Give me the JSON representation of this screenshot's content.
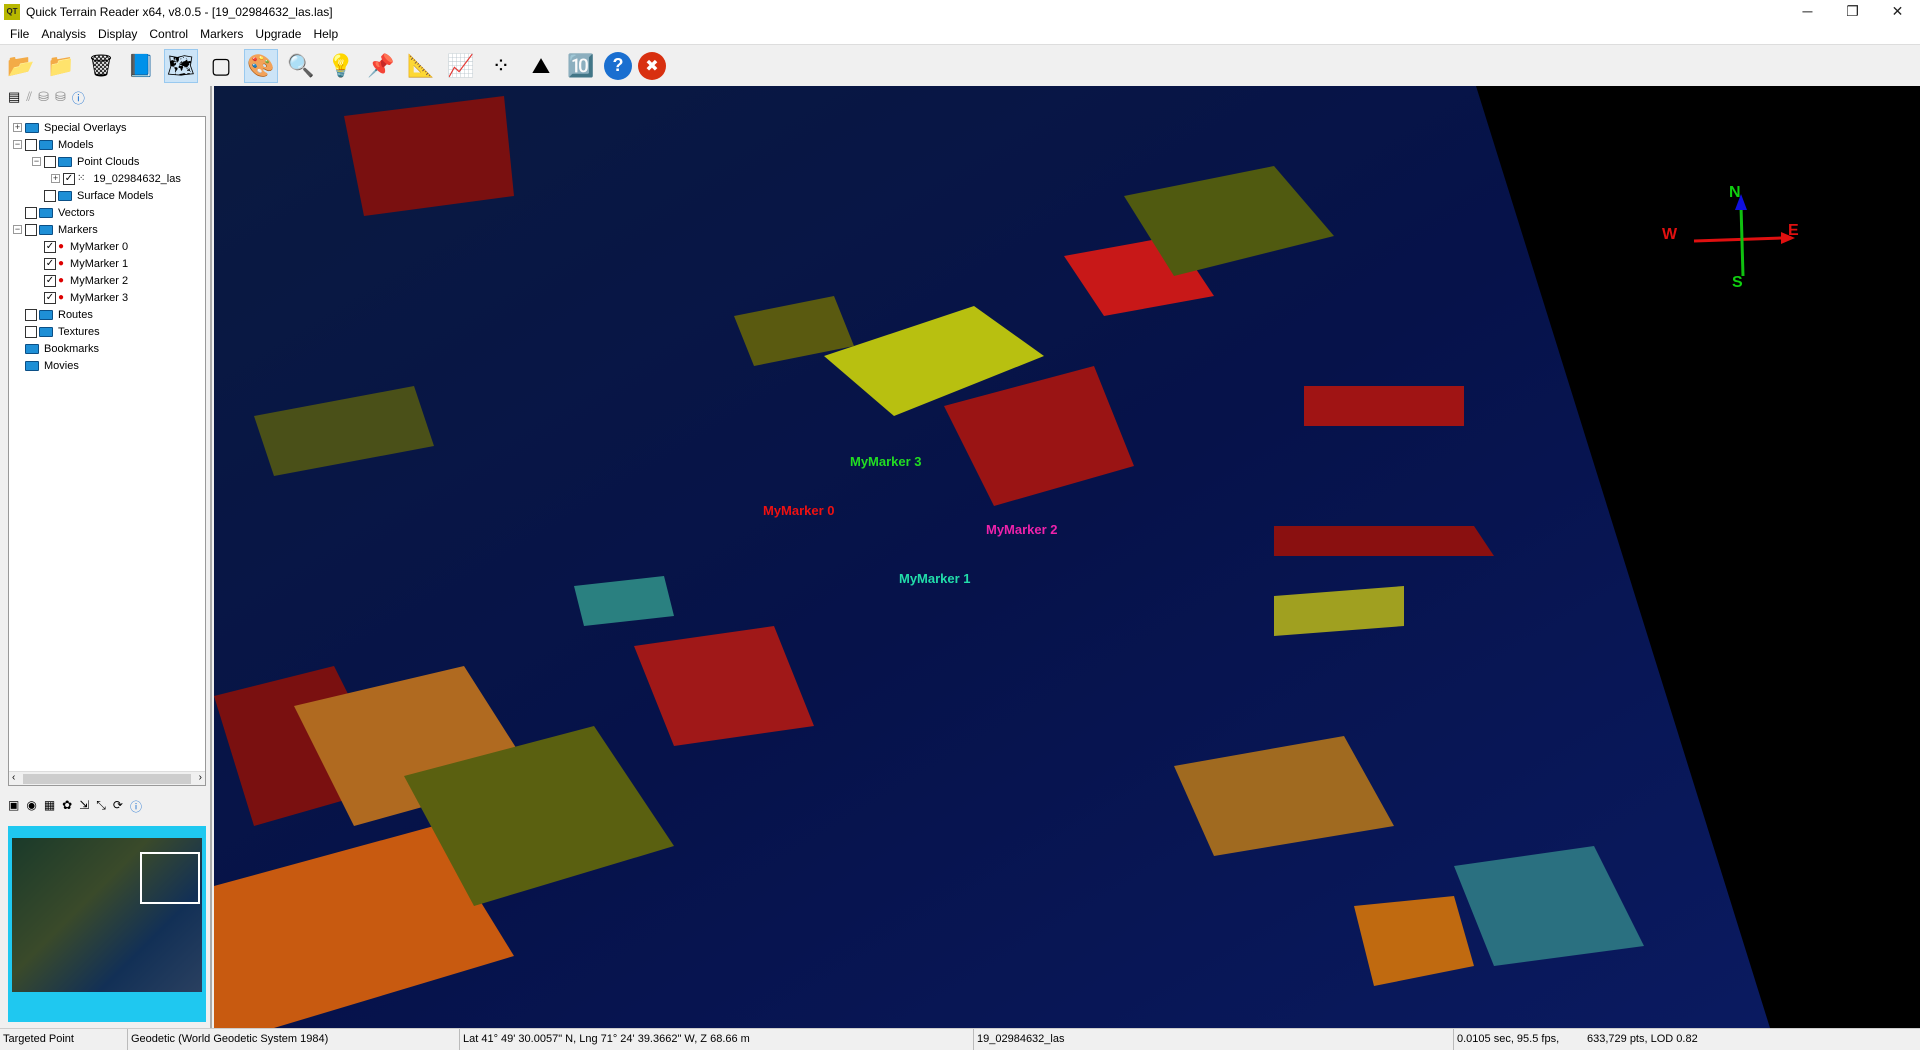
{
  "title": "Quick Terrain Reader x64, v8.0.5 - [19_02984632_las.las]",
  "logo": "QT",
  "window_controls": {
    "min": "─",
    "max": "❐",
    "close": "✕"
  },
  "menu": [
    "File",
    "Analysis",
    "Display",
    "Control",
    "Markers",
    "Upgrade",
    "Help"
  ],
  "toolbar": [
    {
      "icon": "open-folder",
      "g": "📂"
    },
    {
      "icon": "add-folder",
      "g": "📁"
    },
    {
      "icon": "trash",
      "g": "🗑"
    },
    {
      "icon": "book",
      "g": "📘"
    },
    {
      "icon": "heatmap",
      "g": "🗺"
    },
    {
      "icon": "layers",
      "g": "▢"
    },
    {
      "icon": "color",
      "g": "🎨"
    },
    {
      "icon": "zoom-extent",
      "g": "🔍"
    },
    {
      "icon": "light",
      "g": "💡"
    },
    {
      "icon": "pin",
      "g": "📌"
    },
    {
      "icon": "ruler",
      "g": "📐"
    },
    {
      "icon": "profile",
      "g": "📈"
    },
    {
      "icon": "cluster",
      "g": "⁘"
    },
    {
      "icon": "elevation",
      "g": "⛰"
    },
    {
      "icon": "refresh-10",
      "g": "🔟"
    },
    {
      "icon": "help",
      "g": "?"
    },
    {
      "icon": "close",
      "g": "✖"
    }
  ],
  "tree": {
    "special_overlays": "Special Overlays",
    "models": "Models",
    "point_clouds": "Point Clouds",
    "las": "19_02984632_las",
    "surface_models": "Surface Models",
    "vectors": "Vectors",
    "markers": "Markers",
    "m0": "MyMarker 0",
    "m1": "MyMarker 1",
    "m2": "MyMarker 2",
    "m3": "MyMarker 3",
    "routes": "Routes",
    "textures": "Textures",
    "bookmarks": "Bookmarks",
    "movies": "Movies"
  },
  "markers": [
    {
      "label": "MyMarker 3",
      "color": "#22dd22"
    },
    {
      "label": "MyMarker 0",
      "color": "#ee1111"
    },
    {
      "label": "MyMarker 2",
      "color": "#ee22aa"
    },
    {
      "label": "MyMarker 1",
      "color": "#22ddaa"
    }
  ],
  "compass": {
    "n": "N",
    "s": "S",
    "e": "E",
    "w": "W"
  },
  "status": {
    "mode": "Targeted Point",
    "crs": "Geodetic (World Geodetic System 1984)",
    "coords": "Lat 41° 49' 30.0057\" N, Lng 71° 24' 39.3662\" W, Z 68.66 m",
    "file": "19_02984632_las",
    "perf": "0.0105 sec,  95.5 fps,",
    "pts": "633,729 pts, LOD 0.82"
  }
}
